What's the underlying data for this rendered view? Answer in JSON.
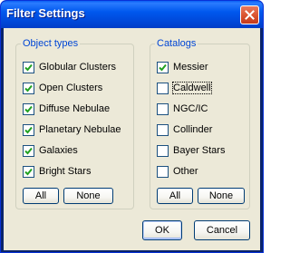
{
  "window": {
    "title": "Filter Settings"
  },
  "object_types": {
    "title": "Object types",
    "items": [
      {
        "label": "Globular Clusters",
        "checked": true
      },
      {
        "label": "Open Clusters",
        "checked": true
      },
      {
        "label": "Diffuse Nebulae",
        "checked": true
      },
      {
        "label": "Planetary Nebulae",
        "checked": true
      },
      {
        "label": "Galaxies",
        "checked": true
      },
      {
        "label": "Bright Stars",
        "checked": true
      }
    ],
    "all_label": "All",
    "none_label": "None"
  },
  "catalogs": {
    "title": "Catalogs",
    "items": [
      {
        "label": "Messier",
        "checked": true
      },
      {
        "label": "Caldwell",
        "checked": false,
        "focused": true
      },
      {
        "label": "NGC/IC",
        "checked": false
      },
      {
        "label": "Collinder",
        "checked": false
      },
      {
        "label": "Bayer Stars",
        "checked": false
      },
      {
        "label": "Other",
        "checked": false
      }
    ],
    "all_label": "All",
    "none_label": "None"
  },
  "footer": {
    "ok_label": "OK",
    "cancel_label": "Cancel"
  },
  "colors": {
    "titlebar": "#0058ee",
    "group_title": "#0046d5",
    "dialog_bg": "#ece9d8",
    "close_button": "#d9532f"
  }
}
